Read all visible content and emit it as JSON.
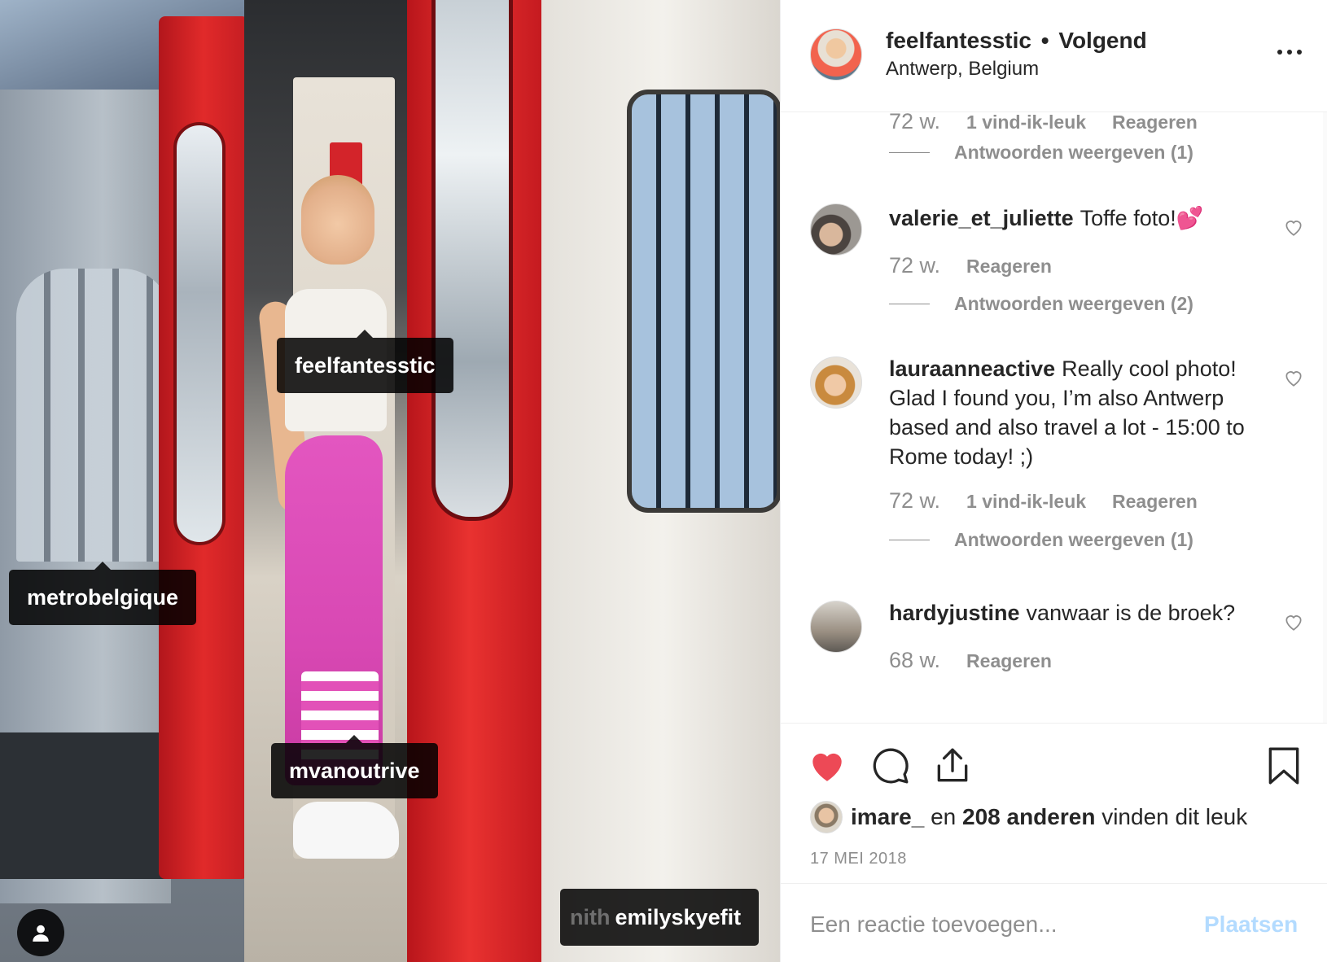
{
  "photo": {
    "tags": {
      "feel": "feelfantesstic",
      "metro": "metrobelgique",
      "mvan": "mvanoutrive",
      "emily_ghost": "nith",
      "emily": "emilyskyefit"
    },
    "user_tags_icon": "person-icon"
  },
  "header": {
    "username": "feelfantesstic",
    "separator": "•",
    "follow_status": "Volgend",
    "location": "Antwerp, Belgium",
    "more_icon": "ellipsis-icon"
  },
  "comments": [
    {
      "id": "prev",
      "time": "72 w.",
      "likes": "1 vind-ik-leuk",
      "reply": "Reageren",
      "view_replies": "Antwoorden weergeven (1)"
    },
    {
      "id": "valerie",
      "username": "valerie_et_juliette",
      "text": "Toffe foto!💕",
      "time": "72 w.",
      "reply": "Reageren",
      "view_replies": "Antwoorden weergeven (2)"
    },
    {
      "id": "laura",
      "username": "lauraanneactive",
      "text": "Really cool photo! Glad I found you, I’m also Antwerp based and also travel a lot - 15:00 to Rome today! ;)",
      "time": "72 w.",
      "likes": "1 vind-ik-leuk",
      "reply": "Reageren",
      "view_replies": "Antwoorden weergeven (1)"
    },
    {
      "id": "hardy",
      "username": "hardyjustine",
      "text": "vanwaar is de broek?",
      "time": "68 w.",
      "reply": "Reageren"
    }
  ],
  "actions": {
    "like_icon": "heart-filled-icon",
    "comment_icon": "comment-icon",
    "share_icon": "share-icon",
    "save_icon": "bookmark-icon",
    "like_color": "#ed4956"
  },
  "likes": {
    "first_user": "imare_",
    "connector": " en ",
    "others": "208 anderen",
    "suffix": " vinden dit leuk"
  },
  "date": "17 MEI 2018",
  "composer": {
    "placeholder": "Een reactie toevoegen...",
    "post_label": "Plaatsen"
  }
}
